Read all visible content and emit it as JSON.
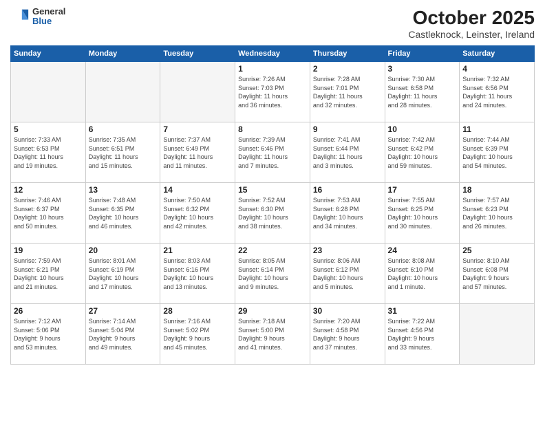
{
  "header": {
    "logo_general": "General",
    "logo_blue": "Blue",
    "month_title": "October 2025",
    "subtitle": "Castleknock, Leinster, Ireland"
  },
  "weekdays": [
    "Sunday",
    "Monday",
    "Tuesday",
    "Wednesday",
    "Thursday",
    "Friday",
    "Saturday"
  ],
  "weeks": [
    [
      {
        "day": "",
        "info": ""
      },
      {
        "day": "",
        "info": ""
      },
      {
        "day": "",
        "info": ""
      },
      {
        "day": "1",
        "info": "Sunrise: 7:26 AM\nSunset: 7:03 PM\nDaylight: 11 hours\nand 36 minutes."
      },
      {
        "day": "2",
        "info": "Sunrise: 7:28 AM\nSunset: 7:01 PM\nDaylight: 11 hours\nand 32 minutes."
      },
      {
        "day": "3",
        "info": "Sunrise: 7:30 AM\nSunset: 6:58 PM\nDaylight: 11 hours\nand 28 minutes."
      },
      {
        "day": "4",
        "info": "Sunrise: 7:32 AM\nSunset: 6:56 PM\nDaylight: 11 hours\nand 24 minutes."
      }
    ],
    [
      {
        "day": "5",
        "info": "Sunrise: 7:33 AM\nSunset: 6:53 PM\nDaylight: 11 hours\nand 19 minutes."
      },
      {
        "day": "6",
        "info": "Sunrise: 7:35 AM\nSunset: 6:51 PM\nDaylight: 11 hours\nand 15 minutes."
      },
      {
        "day": "7",
        "info": "Sunrise: 7:37 AM\nSunset: 6:49 PM\nDaylight: 11 hours\nand 11 minutes."
      },
      {
        "day": "8",
        "info": "Sunrise: 7:39 AM\nSunset: 6:46 PM\nDaylight: 11 hours\nand 7 minutes."
      },
      {
        "day": "9",
        "info": "Sunrise: 7:41 AM\nSunset: 6:44 PM\nDaylight: 11 hours\nand 3 minutes."
      },
      {
        "day": "10",
        "info": "Sunrise: 7:42 AM\nSunset: 6:42 PM\nDaylight: 10 hours\nand 59 minutes."
      },
      {
        "day": "11",
        "info": "Sunrise: 7:44 AM\nSunset: 6:39 PM\nDaylight: 10 hours\nand 54 minutes."
      }
    ],
    [
      {
        "day": "12",
        "info": "Sunrise: 7:46 AM\nSunset: 6:37 PM\nDaylight: 10 hours\nand 50 minutes."
      },
      {
        "day": "13",
        "info": "Sunrise: 7:48 AM\nSunset: 6:35 PM\nDaylight: 10 hours\nand 46 minutes."
      },
      {
        "day": "14",
        "info": "Sunrise: 7:50 AM\nSunset: 6:32 PM\nDaylight: 10 hours\nand 42 minutes."
      },
      {
        "day": "15",
        "info": "Sunrise: 7:52 AM\nSunset: 6:30 PM\nDaylight: 10 hours\nand 38 minutes."
      },
      {
        "day": "16",
        "info": "Sunrise: 7:53 AM\nSunset: 6:28 PM\nDaylight: 10 hours\nand 34 minutes."
      },
      {
        "day": "17",
        "info": "Sunrise: 7:55 AM\nSunset: 6:25 PM\nDaylight: 10 hours\nand 30 minutes."
      },
      {
        "day": "18",
        "info": "Sunrise: 7:57 AM\nSunset: 6:23 PM\nDaylight: 10 hours\nand 26 minutes."
      }
    ],
    [
      {
        "day": "19",
        "info": "Sunrise: 7:59 AM\nSunset: 6:21 PM\nDaylight: 10 hours\nand 21 minutes."
      },
      {
        "day": "20",
        "info": "Sunrise: 8:01 AM\nSunset: 6:19 PM\nDaylight: 10 hours\nand 17 minutes."
      },
      {
        "day": "21",
        "info": "Sunrise: 8:03 AM\nSunset: 6:16 PM\nDaylight: 10 hours\nand 13 minutes."
      },
      {
        "day": "22",
        "info": "Sunrise: 8:05 AM\nSunset: 6:14 PM\nDaylight: 10 hours\nand 9 minutes."
      },
      {
        "day": "23",
        "info": "Sunrise: 8:06 AM\nSunset: 6:12 PM\nDaylight: 10 hours\nand 5 minutes."
      },
      {
        "day": "24",
        "info": "Sunrise: 8:08 AM\nSunset: 6:10 PM\nDaylight: 10 hours\nand 1 minute."
      },
      {
        "day": "25",
        "info": "Sunrise: 8:10 AM\nSunset: 6:08 PM\nDaylight: 9 hours\nand 57 minutes."
      }
    ],
    [
      {
        "day": "26",
        "info": "Sunrise: 7:12 AM\nSunset: 5:06 PM\nDaylight: 9 hours\nand 53 minutes."
      },
      {
        "day": "27",
        "info": "Sunrise: 7:14 AM\nSunset: 5:04 PM\nDaylight: 9 hours\nand 49 minutes."
      },
      {
        "day": "28",
        "info": "Sunrise: 7:16 AM\nSunset: 5:02 PM\nDaylight: 9 hours\nand 45 minutes."
      },
      {
        "day": "29",
        "info": "Sunrise: 7:18 AM\nSunset: 5:00 PM\nDaylight: 9 hours\nand 41 minutes."
      },
      {
        "day": "30",
        "info": "Sunrise: 7:20 AM\nSunset: 4:58 PM\nDaylight: 9 hours\nand 37 minutes."
      },
      {
        "day": "31",
        "info": "Sunrise: 7:22 AM\nSunset: 4:56 PM\nDaylight: 9 hours\nand 33 minutes."
      },
      {
        "day": "",
        "info": ""
      }
    ]
  ]
}
